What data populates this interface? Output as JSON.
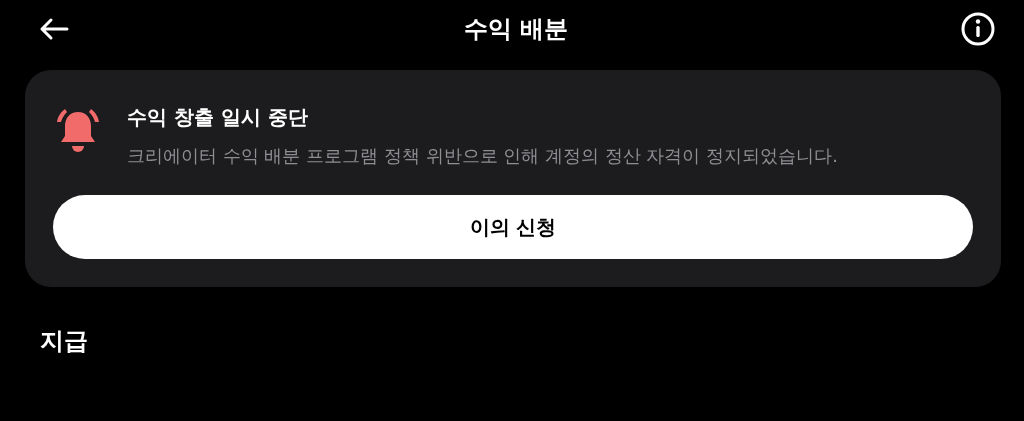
{
  "header": {
    "title": "수익 배분"
  },
  "alert": {
    "title": "수익 창출 일시 중단",
    "message": "크리에이터 수익 배분 프로그램 정책 위반으로 인해 계정의 정산 자격이 정지되었습니다.",
    "action": "이의 신청"
  },
  "section": {
    "title": "지급"
  }
}
